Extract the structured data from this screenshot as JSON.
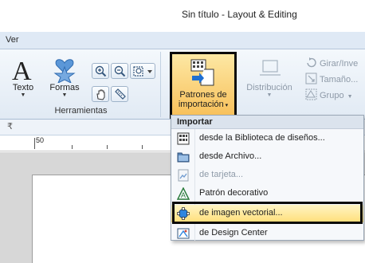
{
  "window": {
    "title": "Sin título - Layout & Editing"
  },
  "tabs": {
    "active": "Ver"
  },
  "ribbon": {
    "texto": "Texto",
    "formas": "Formas",
    "herramientas_label": "Herramientas",
    "patrones_line1": "Patrones de",
    "patrones_line2": "importación",
    "distribucion": "Distribución",
    "girar": "Girar/Inve",
    "tamano": "Tamaño...",
    "grupo": "Grupo"
  },
  "ruler": {
    "label": "50"
  },
  "menu": {
    "header": "Importar",
    "items": [
      {
        "label": "desde la Biblioteca de diseños...",
        "icon": "library-icon",
        "enabled": true
      },
      {
        "label": "desde Archivo...",
        "icon": "folder-icon",
        "enabled": true
      },
      {
        "label": "de tarjeta...",
        "icon": "card-icon",
        "enabled": false
      },
      {
        "label": "Patrón decorativo",
        "icon": "decorative-pattern-icon",
        "enabled": true
      },
      {
        "label": "de imagen vectorial...",
        "icon": "vector-image-icon",
        "enabled": true,
        "highlighted": true
      },
      {
        "label": "de Design Center",
        "icon": "design-center-icon",
        "enabled": true
      }
    ]
  },
  "colors": {
    "ribbon_bg": "#e1eaf4",
    "highlight": "#ffdf7a",
    "accent_blue": "#1f6fd1"
  }
}
